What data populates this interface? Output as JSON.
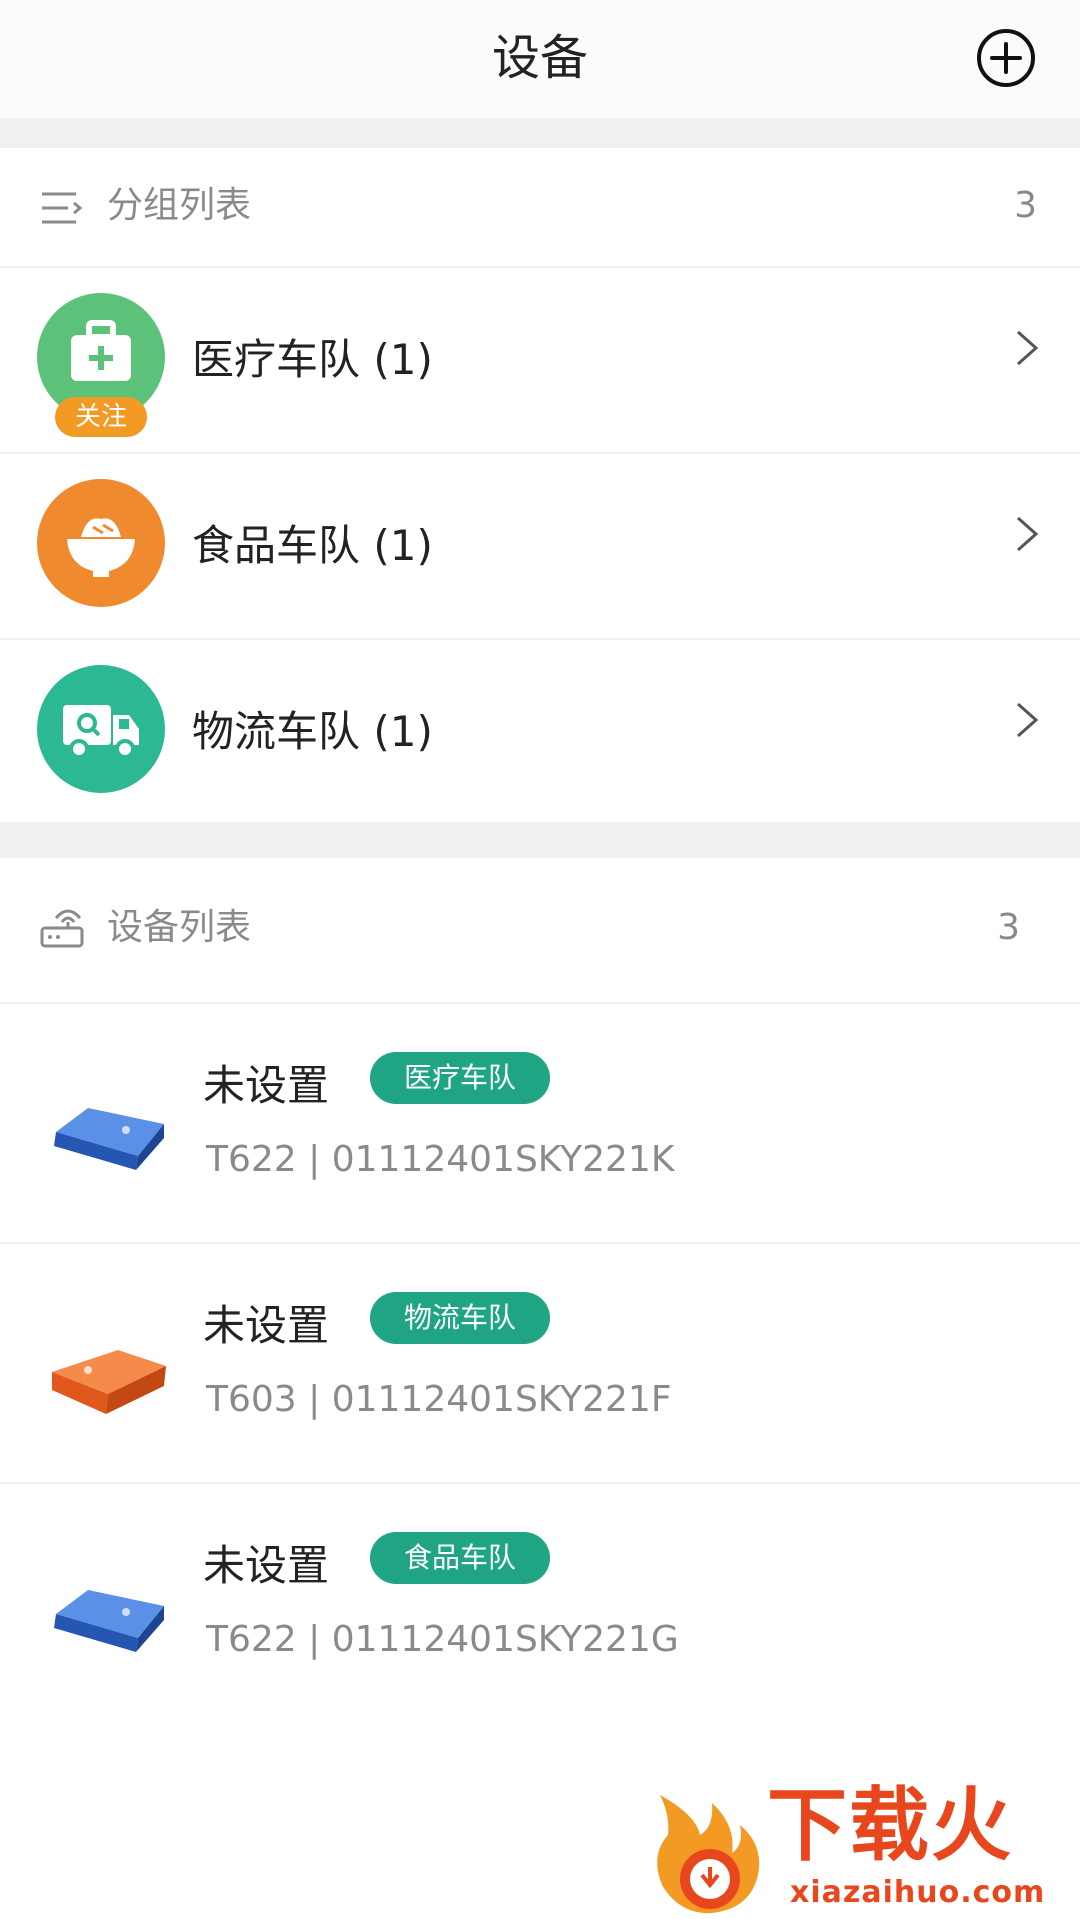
{
  "header": {
    "title": "设备"
  },
  "groups_section": {
    "title": "分组列表",
    "count": "3"
  },
  "groups": [
    {
      "label": "医疗车队 (1)",
      "badge": "关注",
      "color": "#5cc27a"
    },
    {
      "label": "食品车队 (1)",
      "color": "#f08a2e"
    },
    {
      "label": "物流车队 (1)",
      "color": "#2db894"
    }
  ],
  "devices_section": {
    "title": "设备列表",
    "count": "3"
  },
  "devices": [
    {
      "name": "未设置",
      "tag": "医疗车队",
      "sub": "T622 | 01112401SKY221K",
      "color": "#2f6fd1"
    },
    {
      "name": "未设置",
      "tag": "物流车队",
      "sub": "T603 | 01112401SKY221F",
      "color": "#ec6a25"
    },
    {
      "name": "未设置",
      "tag": "食品车队",
      "sub": "T622 | 01112401SKY221G",
      "color": "#2f6fd1"
    }
  ],
  "colors": {
    "accent_tag": "#1fa584",
    "badge": "#f29a23",
    "watermark": "#e8471d"
  },
  "watermark": {
    "text": "下载火",
    "url": "xiazaihuo.com"
  }
}
